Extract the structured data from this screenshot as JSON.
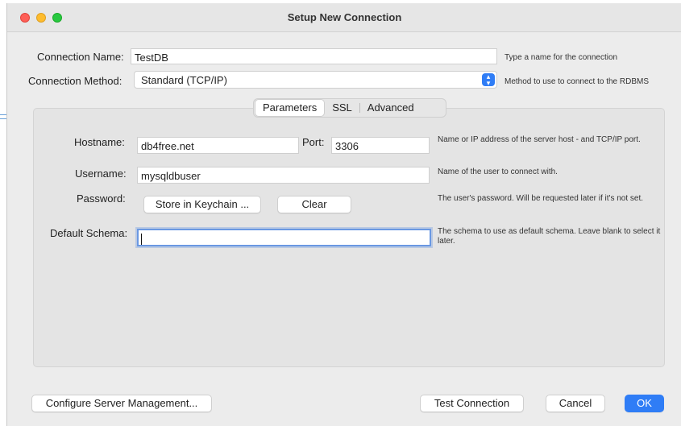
{
  "window": {
    "title": "Setup New Connection"
  },
  "connection": {
    "name_label": "Connection Name:",
    "name_value": "TestDB",
    "name_hint": "Type a name for the connection",
    "method_label": "Connection Method:",
    "method_value": "Standard (TCP/IP)",
    "method_hint": "Method to use to connect to the RDBMS"
  },
  "tabs": [
    {
      "label": "Parameters",
      "active": true
    },
    {
      "label": "SSL",
      "active": false
    },
    {
      "label": "Advanced",
      "active": false
    }
  ],
  "parameters": {
    "hostname_label": "Hostname:",
    "hostname_value": "db4free.net",
    "port_label": "Port:",
    "port_value": "3306",
    "hostname_hint": "Name or IP address of the server host - and TCP/IP port.",
    "username_label": "Username:",
    "username_value": "mysqldbuser",
    "username_hint": "Name of the user to connect with.",
    "password_label": "Password:",
    "store_keychain_label": "Store in Keychain ...",
    "clear_label": "Clear",
    "password_hint": "The user's password. Will be requested later if it's not set.",
    "schema_label": "Default Schema:",
    "schema_value": "",
    "schema_hint": "The schema to use as default schema. Leave blank to select it later."
  },
  "footer": {
    "configure_label": "Configure Server Management...",
    "test_label": "Test Connection",
    "cancel_label": "Cancel",
    "ok_label": "OK"
  },
  "colors": {
    "accent": "#2f7df6",
    "close": "#fe5f57",
    "minimize": "#febc2e",
    "maximize": "#28c840"
  }
}
